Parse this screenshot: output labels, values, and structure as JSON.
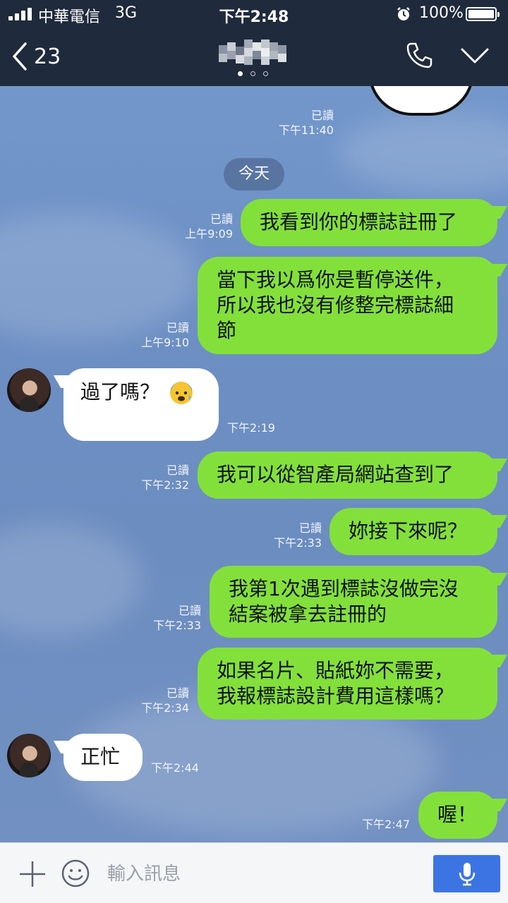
{
  "status_bar": {
    "carrier": "中華電信",
    "network": "3G",
    "time": "下午2:48",
    "battery_percent": "100%"
  },
  "header": {
    "back_count": "23",
    "page_dots": 3,
    "active_page": 0,
    "icons": [
      "back-chevron-icon",
      "phone-icon",
      "chevron-down-icon"
    ]
  },
  "chat": {
    "prev": {
      "read": "已讀",
      "time": "下午11:40"
    },
    "date_divider": "今天",
    "messages": [
      {
        "from": "me",
        "text": "我看到你的標誌註冊了",
        "read": "已讀",
        "time": "上午9:09"
      },
      {
        "from": "me",
        "text": "當下我以爲你是暫停送件，\n所以我也沒有修整完標誌細\n節",
        "read": "已讀",
        "time": "上午9:10"
      },
      {
        "from": "them",
        "text": "過了嗎？",
        "emoji": "anxious-sweat-face",
        "time": "下午2:19"
      },
      {
        "from": "me",
        "text": "我可以從智產局網站查到了",
        "read": "已讀",
        "time": "下午2:32"
      },
      {
        "from": "me",
        "text": "妳接下來呢？",
        "read": "已讀",
        "time": "下午2:33"
      },
      {
        "from": "me",
        "text": "我第1次遇到標誌沒做完沒\n結案被拿去註冊的",
        "read": "已讀",
        "time": "下午2:33"
      },
      {
        "from": "me",
        "text": "如果名片、貼紙妳不需要，\n我報標誌設計費用這樣嗎？",
        "read": "已讀",
        "time": "下午2:34"
      },
      {
        "from": "them",
        "text": "正忙",
        "time": "下午2:44"
      },
      {
        "from": "me",
        "text": "喔！",
        "time": "下午2:47"
      }
    ]
  },
  "input_bar": {
    "placeholder": "輸入訊息",
    "value": ""
  },
  "colors": {
    "header_bg": "#1f2a3c",
    "my_bubble": "#83e03b",
    "their_bubble": "#ffffff",
    "chat_bg": "#6f90c2",
    "mic_button": "#3d74e3"
  }
}
